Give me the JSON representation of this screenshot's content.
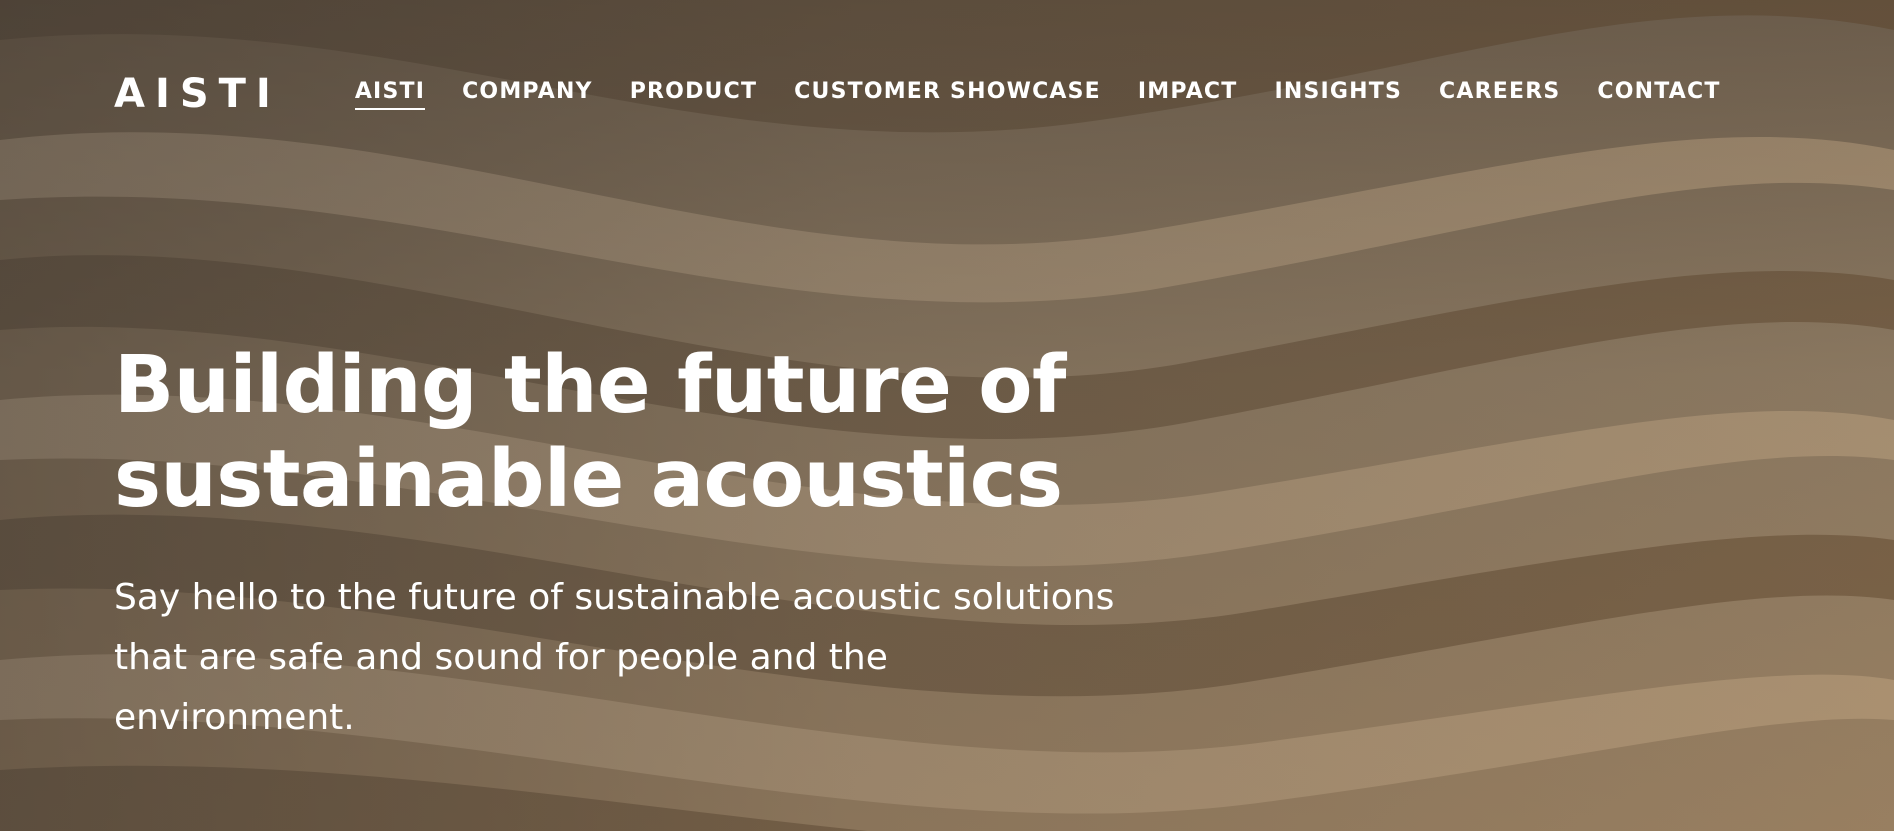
{
  "brand": {
    "logo_text": "AISTI"
  },
  "nav": {
    "items": [
      {
        "label": "AISTI",
        "active": true
      },
      {
        "label": "COMPANY"
      },
      {
        "label": "PRODUCT"
      },
      {
        "label": "CUSTOMER SHOWCASE"
      },
      {
        "label": "IMPACT"
      },
      {
        "label": "INSIGHTS"
      },
      {
        "label": "CAREERS"
      },
      {
        "label": "CONTACT"
      }
    ]
  },
  "hero": {
    "headline_line1": "Building the future of",
    "headline_line2": "sustainable acoustics",
    "subtext_line1": "Say hello to the future of sustainable acoustic solutions",
    "subtext_line2": "that are safe and sound for people and the",
    "subtext_line3": "environment.",
    "background_image": "wavy acoustic panel texture"
  },
  "colors": {
    "text": "#ffffff",
    "background_tone": "#8a7458"
  }
}
